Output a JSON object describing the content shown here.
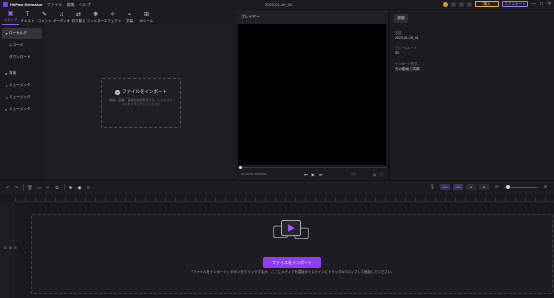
{
  "titlebar": {
    "app_name": "HitPaw Edimakor",
    "menu": [
      "ファイル",
      "編集",
      "ヘルプ"
    ],
    "project_title": "2023-01-19_01",
    "buy_label": "購入",
    "export_label": "エクスポート",
    "minimize": "—",
    "maximize": "□",
    "close": "✕"
  },
  "toolbar": {
    "tools": [
      {
        "icon": "▣",
        "label": "メディア",
        "icon_name": "media-icon"
      },
      {
        "icon": "T",
        "label": "テキスト",
        "icon_name": "text-icon"
      },
      {
        "icon": "✎",
        "label": "コメント",
        "icon_name": "comment-icon"
      },
      {
        "icon": "♫",
        "label": "オーディオ",
        "icon_name": "audio-icon"
      },
      {
        "icon": "⇄",
        "label": "切り替え",
        "icon_name": "transition-icon"
      },
      {
        "icon": "❋",
        "label": "フィルター",
        "icon_name": "filter-icon"
      },
      {
        "icon": "✧",
        "label": "エフェクト",
        "icon_name": "effect-icon"
      },
      {
        "icon": "⌁",
        "label": "字幕",
        "icon_name": "subtitle-icon"
      },
      {
        "icon": "⊞",
        "label": "AIツール",
        "icon_name": "ai-tools-icon"
      }
    ]
  },
  "sidebar": {
    "items": [
      {
        "icon": "▾",
        "label": "ローカルデ"
      },
      {
        "icon": "",
        "label": "レコード"
      },
      {
        "icon": "",
        "label": "ダウンロード"
      },
      {
        "icon": "▸",
        "label": "背景"
      },
      {
        "icon": "♪",
        "label": "ミュージック"
      },
      {
        "icon": "♫",
        "label": "ミュージック"
      },
      {
        "icon": "♬",
        "label": "ミュージック"
      }
    ]
  },
  "media": {
    "import_title": "ファイルをインポート",
    "import_desc": "動画、画像、音楽の追加を行うか、ここにファイルをドラッグしてください"
  },
  "player": {
    "title": "プレイヤー",
    "time": "00:00:00 / 00:00:00",
    "prev": "⏮",
    "play": "▶",
    "next": "⏭",
    "quality": "フル",
    "screenshot_icon": "◎",
    "fullscreen_icon": "⛶"
  },
  "properties": {
    "tab": "詳細",
    "fields": [
      {
        "label": "名前",
        "value": "2023-01-19_01"
      },
      {
        "label": "フレームレート",
        "value": "30"
      },
      {
        "label": "インポート形式",
        "value": "元の動画と同期"
      }
    ]
  },
  "timeline_toolbar": {
    "left_icons": [
      "↶",
      "↷",
      "🗑",
      "▭",
      "✂",
      "⧉",
      "⊕",
      "◉",
      "⊙"
    ],
    "chips": [
      "⊟⊟",
      "⊟⊟",
      "⊟",
      "⊞"
    ],
    "zoom_minus": "⊖",
    "zoom_plus": "⊕",
    "zoom_level": 0.05,
    "mic_icon": "🎙"
  },
  "timeline": {
    "track_controls": [
      "⊟",
      "⊞",
      "⊟"
    ],
    "drop_desc": "「ファイルをインポート」ボタンをクリックするか、ここにメディアを直接タイムラインにドラッグ&ドロップして追加してください。",
    "import_button": "ファイルをインポート"
  },
  "colors": {
    "accent": "#8b3fef",
    "buy": "#e0b440",
    "background": "#141418"
  }
}
